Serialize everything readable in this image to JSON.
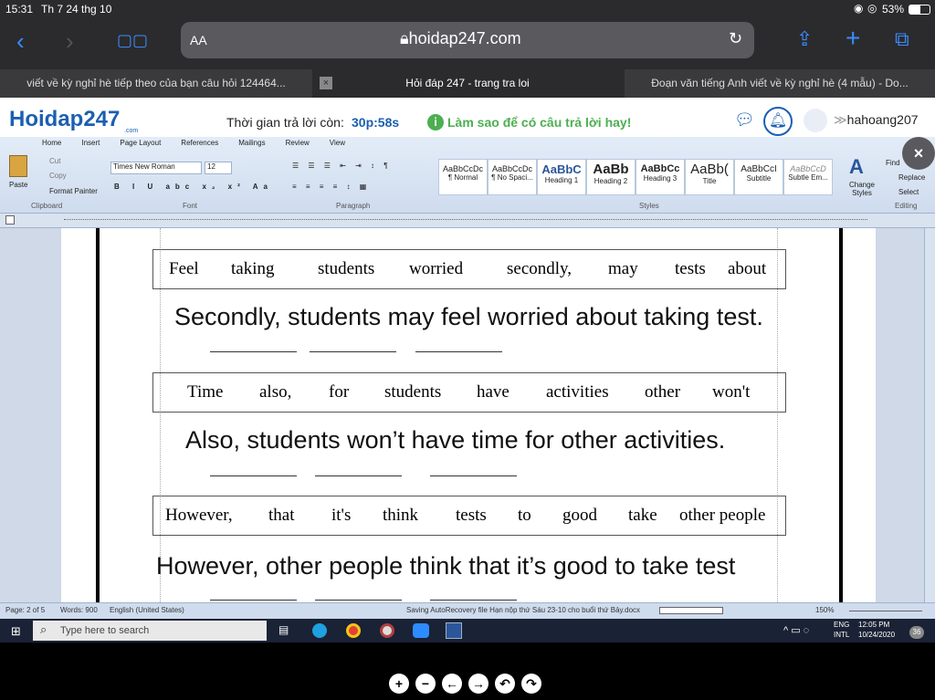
{
  "status": {
    "time": "15:31",
    "date": "Th 7 24 thg 10",
    "battery": "53%"
  },
  "browser": {
    "reader_label": "AA",
    "url": "hoidap247.com"
  },
  "tabs": [
    {
      "title": "viết về kỳ nghỉ hè tiếp theo của bạn câu hỏi 124464..."
    },
    {
      "title": "Hỏi đáp 247 - trang tra loi"
    },
    {
      "title": "Đoạn văn tiếng Anh viết về kỳ nghỉ hè (4 mẫu) - Do..."
    }
  ],
  "site": {
    "logo": "Hoidap247",
    "logo_sub": ".com",
    "timer_label": "Thời gian trả lời còn:",
    "timer": "30p:58s",
    "tip": "Làm sao để có câu trả lời hay!",
    "username": "hahoang207"
  },
  "ribbon": {
    "tabs": [
      "Home",
      "Insert",
      "Page Layout",
      "References",
      "Mailings",
      "Review",
      "View"
    ],
    "paste": "Paste",
    "cut": "Cut",
    "copy": "Copy",
    "format_painter": "Format Painter",
    "clipboard": "Clipboard",
    "font_name": "Times New Roman",
    "font_size": "12",
    "font_group": "Font",
    "paragraph_group": "Paragraph",
    "styles": [
      {
        "preview": "AaBbCcDc",
        "name": "¶ Normal"
      },
      {
        "preview": "AaBbCcDc",
        "name": "¶ No Spaci..."
      },
      {
        "preview": "AaBbC",
        "name": "Heading 1"
      },
      {
        "preview": "AaBb",
        "name": "Heading 2"
      },
      {
        "preview": "AaBbCc",
        "name": "Heading 3"
      },
      {
        "preview": "AaBb(",
        "name": "Title"
      },
      {
        "preview": "AaBbCcI",
        "name": "Subtitle"
      },
      {
        "preview": "AaBbCcD",
        "name": "Subtle Em..."
      }
    ],
    "styles_group": "Styles",
    "change_styles": "Change Styles",
    "find": "Find",
    "replace": "Replace",
    "select": "Select",
    "editing": "Editing"
  },
  "exercises": [
    {
      "words": [
        "Feel",
        "taking",
        "students",
        "worried",
        "secondly,",
        "may",
        "tests",
        "about"
      ],
      "answer": "Secondly, students may feel worried about taking test."
    },
    {
      "words": [
        "Time",
        "also,",
        "for",
        "students",
        "have",
        "activities",
        "other",
        "won't"
      ],
      "answer": "Also, students won’t have time for other activities."
    },
    {
      "words": [
        "However,",
        "that",
        "it's",
        "think",
        "tests",
        "to",
        "good",
        "take",
        "other people"
      ],
      "answer": "However, other people think that it’s good to take test"
    }
  ],
  "word_status": {
    "page": "Page: 2 of 5",
    "words": "Words: 900",
    "lang": "English (United States)",
    "saving": "Saving AutoRecovery file Hạn nộp thứ Sáu 23-10 cho buổi thứ Bảy.docx",
    "zoom": "150%"
  },
  "taskbar": {
    "search_placeholder": "Type here to search",
    "lang1": "ENG",
    "lang2": "INTL",
    "clock": "12:05 PM",
    "date": "10/24/2020",
    "notif": "36"
  },
  "bottom_controls": [
    "+",
    "−",
    "←",
    "→",
    "↶",
    "↷"
  ]
}
